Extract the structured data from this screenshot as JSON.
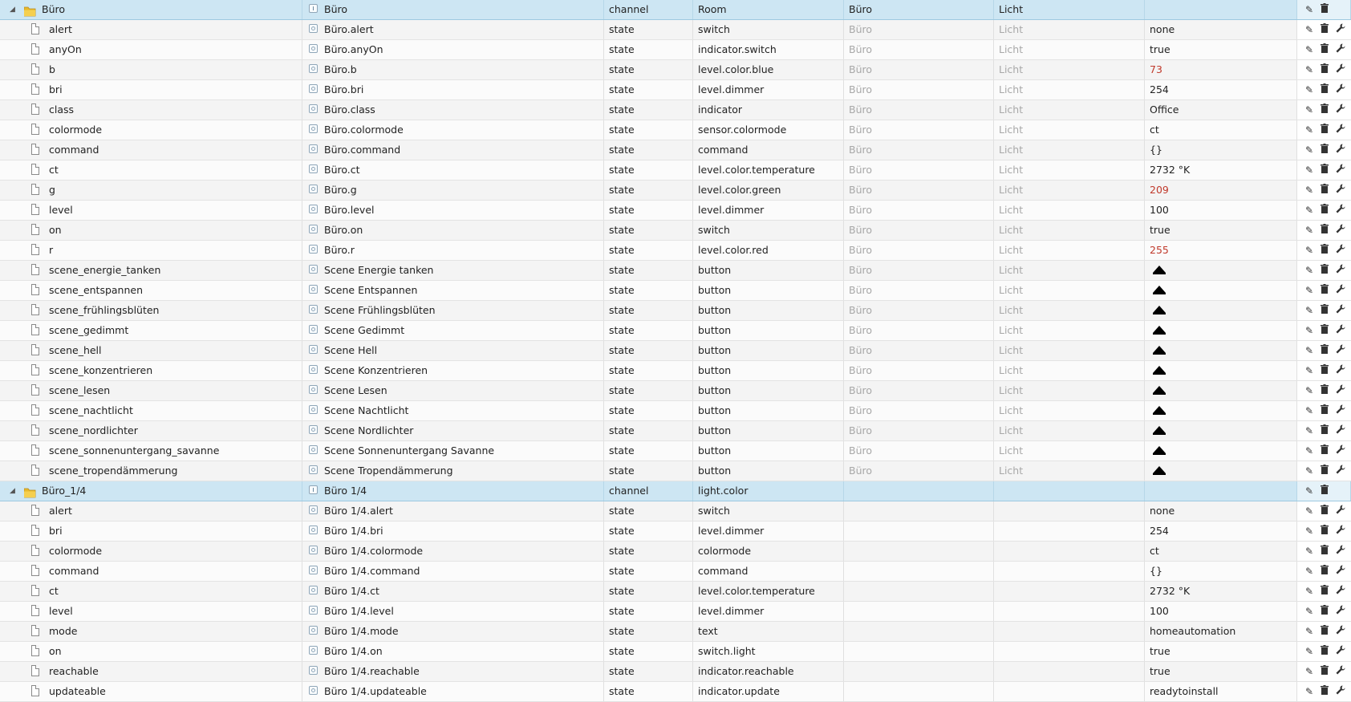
{
  "icons": {
    "edit": "pencil-icon",
    "delete": "trash-icon",
    "custom": "wrench-icon",
    "folder": "folder-icon",
    "file": "file-icon",
    "button_value": "button-icon"
  },
  "colors": {
    "folder_row": "#cde6f3",
    "value_red": "#c0392b"
  },
  "rows": [
    {
      "kind": "folder",
      "id": "Büro",
      "name": "Büro",
      "type": "channel",
      "role": "Room",
      "room": "Büro",
      "func": "Licht",
      "value": ""
    },
    {
      "kind": "state",
      "id": "alert",
      "name": "Büro.alert",
      "type": "state",
      "role": "switch",
      "room": "Büro",
      "func": "Licht",
      "value": "none"
    },
    {
      "kind": "state",
      "id": "anyOn",
      "name": "Büro.anyOn",
      "type": "state",
      "role": "indicator.switch",
      "room": "Büro",
      "func": "Licht",
      "value": "true"
    },
    {
      "kind": "state",
      "id": "b",
      "name": "Büro.b",
      "type": "state",
      "role": "level.color.blue",
      "room": "Büro",
      "func": "Licht",
      "value": "73",
      "red": true
    },
    {
      "kind": "state",
      "id": "bri",
      "name": "Büro.bri",
      "type": "state",
      "role": "level.dimmer",
      "room": "Büro",
      "func": "Licht",
      "value": "254"
    },
    {
      "kind": "state",
      "id": "class",
      "name": "Büro.class",
      "type": "state",
      "role": "indicator",
      "room": "Büro",
      "func": "Licht",
      "value": "Office"
    },
    {
      "kind": "state",
      "id": "colormode",
      "name": "Büro.colormode",
      "type": "state",
      "role": "sensor.colormode",
      "room": "Büro",
      "func": "Licht",
      "value": "ct"
    },
    {
      "kind": "state",
      "id": "command",
      "name": "Büro.command",
      "type": "state",
      "role": "command",
      "room": "Büro",
      "func": "Licht",
      "value": "{}"
    },
    {
      "kind": "state",
      "id": "ct",
      "name": "Büro.ct",
      "type": "state",
      "role": "level.color.temperature",
      "room": "Büro",
      "func": "Licht",
      "value": "2732 °K"
    },
    {
      "kind": "state",
      "id": "g",
      "name": "Büro.g",
      "type": "state",
      "role": "level.color.green",
      "room": "Büro",
      "func": "Licht",
      "value": "209",
      "red": true
    },
    {
      "kind": "state",
      "id": "level",
      "name": "Büro.level",
      "type": "state",
      "role": "level.dimmer",
      "room": "Büro",
      "func": "Licht",
      "value": "100"
    },
    {
      "kind": "state",
      "id": "on",
      "name": "Büro.on",
      "type": "state",
      "role": "switch",
      "room": "Büro",
      "func": "Licht",
      "value": "true"
    },
    {
      "kind": "state",
      "id": "r",
      "name": "Büro.r",
      "type": "state",
      "role": "level.color.red",
      "room": "Büro",
      "func": "Licht",
      "value": "255",
      "red": true
    },
    {
      "kind": "state",
      "id": "scene_energie_tanken",
      "name": "Scene Energie tanken",
      "type": "state",
      "role": "button",
      "room": "Büro",
      "func": "Licht",
      "button": true
    },
    {
      "kind": "state",
      "id": "scene_entspannen",
      "name": "Scene Entspannen",
      "type": "state",
      "role": "button",
      "room": "Büro",
      "func": "Licht",
      "button": true
    },
    {
      "kind": "state",
      "id": "scene_frühlingsblüten",
      "name": "Scene Frühlingsblüten",
      "type": "state",
      "role": "button",
      "room": "Büro",
      "func": "Licht",
      "button": true
    },
    {
      "kind": "state",
      "id": "scene_gedimmt",
      "name": "Scene Gedimmt",
      "type": "state",
      "role": "button",
      "room": "Büro",
      "func": "Licht",
      "button": true
    },
    {
      "kind": "state",
      "id": "scene_hell",
      "name": "Scene Hell",
      "type": "state",
      "role": "button",
      "room": "Büro",
      "func": "Licht",
      "button": true
    },
    {
      "kind": "state",
      "id": "scene_konzentrieren",
      "name": "Scene Konzentrieren",
      "type": "state",
      "role": "button",
      "room": "Büro",
      "func": "Licht",
      "button": true
    },
    {
      "kind": "state",
      "id": "scene_lesen",
      "name": "Scene Lesen",
      "type": "state",
      "role": "button",
      "room": "Büro",
      "func": "Licht",
      "button": true
    },
    {
      "kind": "state",
      "id": "scene_nachtlicht",
      "name": "Scene Nachtlicht",
      "type": "state",
      "role": "button",
      "room": "Büro",
      "func": "Licht",
      "button": true
    },
    {
      "kind": "state",
      "id": "scene_nordlichter",
      "name": "Scene Nordlichter",
      "type": "state",
      "role": "button",
      "room": "Büro",
      "func": "Licht",
      "button": true
    },
    {
      "kind": "state",
      "id": "scene_sonnenuntergang_savanne",
      "name": "Scene Sonnenuntergang Savanne",
      "type": "state",
      "role": "button",
      "room": "Büro",
      "func": "Licht",
      "button": true
    },
    {
      "kind": "state",
      "id": "scene_tropendämmerung",
      "name": "Scene Tropendämmerung",
      "type": "state",
      "role": "button",
      "room": "Büro",
      "func": "Licht",
      "button": true
    },
    {
      "kind": "folder",
      "id": "Büro_1/4",
      "name": "Büro 1/4",
      "type": "channel",
      "role": "light.color",
      "room": "",
      "func": "",
      "value": ""
    },
    {
      "kind": "state",
      "id": "alert",
      "name": "Büro 1/4.alert",
      "type": "state",
      "role": "switch",
      "room": "",
      "func": "",
      "value": "none"
    },
    {
      "kind": "state",
      "id": "bri",
      "name": "Büro 1/4.bri",
      "type": "state",
      "role": "level.dimmer",
      "room": "",
      "func": "",
      "value": "254"
    },
    {
      "kind": "state",
      "id": "colormode",
      "name": "Büro 1/4.colormode",
      "type": "state",
      "role": "colormode",
      "room": "",
      "func": "",
      "value": "ct"
    },
    {
      "kind": "state",
      "id": "command",
      "name": "Büro 1/4.command",
      "type": "state",
      "role": "command",
      "room": "",
      "func": "",
      "value": "{}"
    },
    {
      "kind": "state",
      "id": "ct",
      "name": "Büro 1/4.ct",
      "type": "state",
      "role": "level.color.temperature",
      "room": "",
      "func": "",
      "value": "2732 °K"
    },
    {
      "kind": "state",
      "id": "level",
      "name": "Büro 1/4.level",
      "type": "state",
      "role": "level.dimmer",
      "room": "",
      "func": "",
      "value": "100"
    },
    {
      "kind": "state",
      "id": "mode",
      "name": "Büro 1/4.mode",
      "type": "state",
      "role": "text",
      "room": "",
      "func": "",
      "value": "homeautomation"
    },
    {
      "kind": "state",
      "id": "on",
      "name": "Büro 1/4.on",
      "type": "state",
      "role": "switch.light",
      "room": "",
      "func": "",
      "value": "true"
    },
    {
      "kind": "state",
      "id": "reachable",
      "name": "Büro 1/4.reachable",
      "type": "state",
      "role": "indicator.reachable",
      "room": "",
      "func": "",
      "value": "true"
    },
    {
      "kind": "state",
      "id": "updateable",
      "name": "Büro 1/4.updateable",
      "type": "state",
      "role": "indicator.update",
      "room": "",
      "func": "",
      "value": "readytoinstall"
    }
  ]
}
